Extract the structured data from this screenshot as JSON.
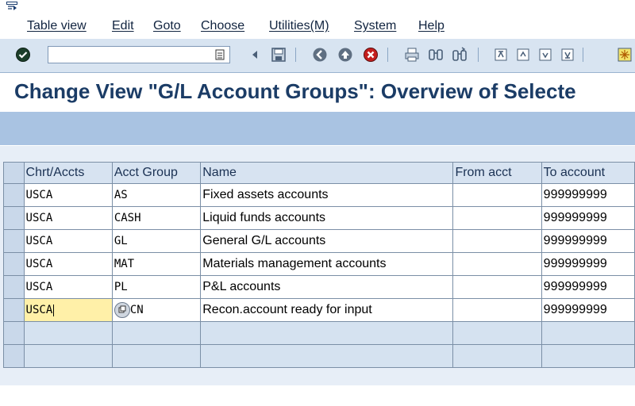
{
  "menu": {
    "items": [
      "Table view",
      "Edit",
      "Goto",
      "Choose",
      "Utilities(M)",
      "System",
      "Help"
    ]
  },
  "toolbar": {
    "command_value": "",
    "buttons": [
      "enter-icon",
      "back-nav-icon",
      "save-icon",
      "back-icon",
      "exit-icon",
      "cancel-icon",
      "print-icon",
      "find-icon",
      "find-next-icon",
      "first-page-icon",
      "previous-page-icon",
      "next-page-icon",
      "last-page-icon",
      "new-session-icon"
    ]
  },
  "page": {
    "title": "Change View \"G/L Account Groups\": Overview of Selecte"
  },
  "table": {
    "columns": [
      "Chrt/Accts",
      "Acct Group",
      "Name",
      "From acct",
      "To account"
    ],
    "rows": [
      [
        "USCA",
        "AS",
        "Fixed assets accounts",
        "",
        "999999999"
      ],
      [
        "USCA",
        "CASH",
        "Liquid funds accounts",
        "",
        "999999999"
      ],
      [
        "USCA",
        "GL",
        "General G/L accounts",
        "",
        "999999999"
      ],
      [
        "USCA",
        "MAT",
        "Materials management accounts",
        "",
        "999999999"
      ],
      [
        "USCA",
        "PL",
        "P&L accounts",
        "",
        "999999999"
      ],
      [
        "USCA",
        "CN",
        "Recon.account ready for input",
        "",
        "999999999"
      ]
    ]
  },
  "colors": {
    "toolbar_bg": "#d8e4f1",
    "title": "#1b3c66",
    "focus_cell": "#fff0a8"
  }
}
